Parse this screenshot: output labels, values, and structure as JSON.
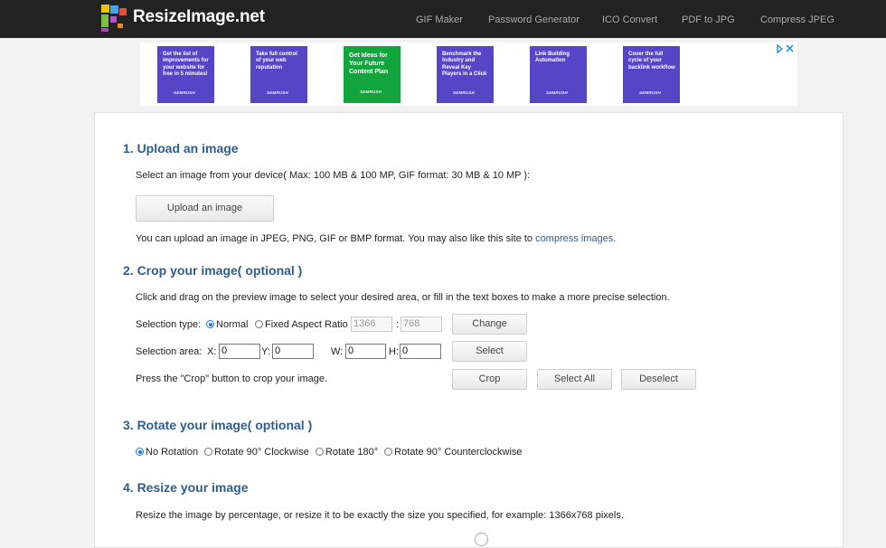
{
  "header": {
    "brand": "ResizeImage.net",
    "nav": [
      "GIF Maker",
      "Password Generator",
      "ICO Convert",
      "PDF to JPG",
      "Compress JPEG"
    ]
  },
  "ads": [
    {
      "text": "Get the list of improvements for your website for free in 5 minutes!",
      "brand": "SEMRUSH",
      "color": "#5546c8"
    },
    {
      "text": "Take full control of your web reputation",
      "brand": "SEMRUSH",
      "color": "#5546c8"
    },
    {
      "text": "Get Ideas for Your Future Content Plan",
      "brand": "SEMRUSH",
      "color": "#12a53d"
    },
    {
      "text": "Benchmark the Industry and Reveal Key Players in a Click",
      "brand": "SEMRUSH",
      "color": "#5546c8"
    },
    {
      "text": "Link Building Automation",
      "brand": "SEMRUSH",
      "color": "#5546c8"
    },
    {
      "text": "Cover the full cycle of your backlink workflow",
      "brand": "SEMRUSH",
      "color": "#5546c8"
    }
  ],
  "step1": {
    "title": "1. Upload an image",
    "desc": "Select an image from your device( Max: 100 MB & 100 MP, GIF format: 30 MB & 10 MP ):",
    "button": "Upload an image",
    "note": "You can upload an image in JPEG, PNG, GIF or BMP format. You may also like this site to ",
    "note_link": "compress images",
    "note_end": "."
  },
  "step2": {
    "title": "2. Crop your image( optional )",
    "desc": "Click and drag on the preview image to select your desired area, or fill in the text boxes to make a more precise selection.",
    "selection_type_label": "Selection type:",
    "normal": "Normal",
    "fixed": "Fixed Aspect Ratio",
    "ratio_w": "1366",
    "ratio_sep": ":",
    "ratio_h": "768",
    "change": "Change",
    "area_label": "Selection area:",
    "x_label": "X:",
    "x": "0",
    "y_label": "Y:",
    "y": "0",
    "w_label": "W:",
    "w": "0",
    "h_label": "H:",
    "h": "0",
    "select": "Select",
    "crop_note": "Press the \"Crop\" button to crop your image.",
    "crop": "Crop",
    "select_all": "Select All",
    "deselect": "Deselect"
  },
  "step3": {
    "title": "3. Rotate your image( optional )",
    "options": [
      "No Rotation",
      "Rotate 90° Clockwise",
      "Rotate 180°",
      "Rotate 90° Counterclockwise"
    ],
    "selected": "No Rotation"
  },
  "step4": {
    "title": "4. Resize your image",
    "desc": "Resize the image by percentage, or resize it to be exactly the size you specified, for example: 1366x768 pixels."
  }
}
